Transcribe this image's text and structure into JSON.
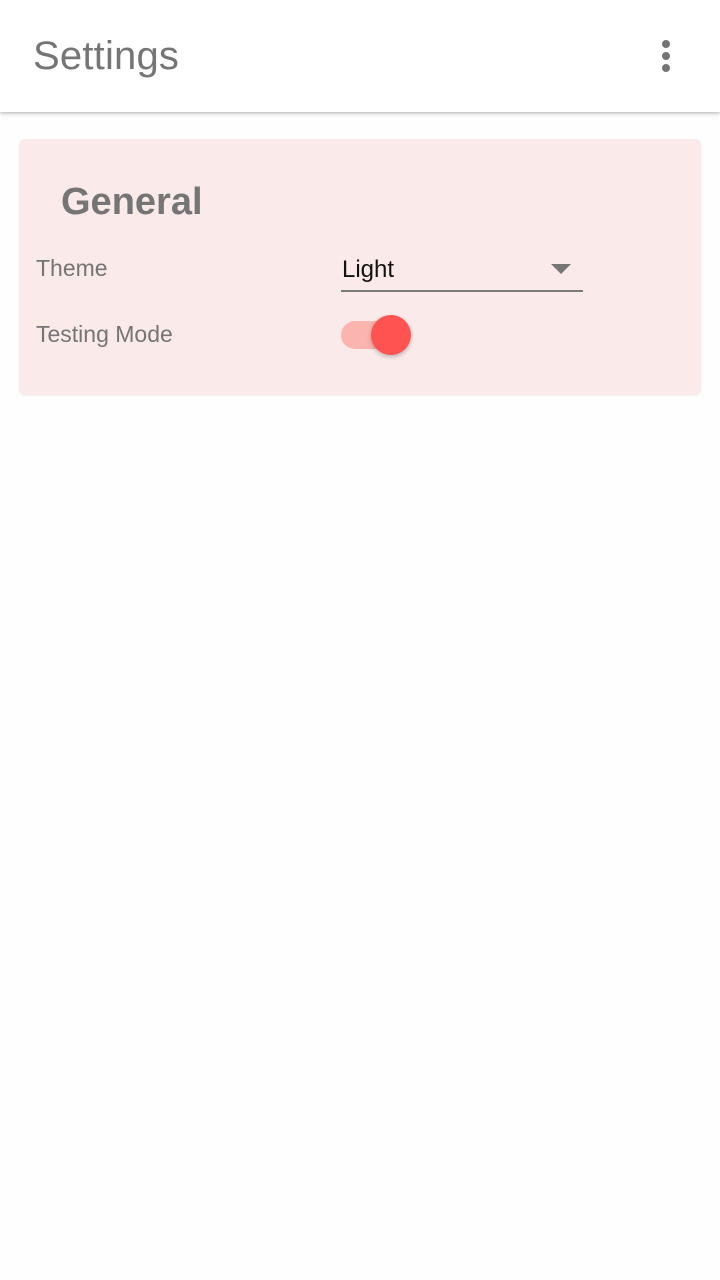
{
  "app_bar": {
    "title": "Settings",
    "menu_icon": "more-vert-icon"
  },
  "general": {
    "title": "General",
    "theme": {
      "label": "Theme",
      "selected": "Light",
      "arrow_icon": "arrow-drop-down-icon"
    },
    "testing_mode": {
      "label": "Testing Mode",
      "enabled": true
    }
  },
  "colors": {
    "accent": "#fe5350",
    "card_background": "#fbeaea",
    "text_secondary": "#757575"
  }
}
